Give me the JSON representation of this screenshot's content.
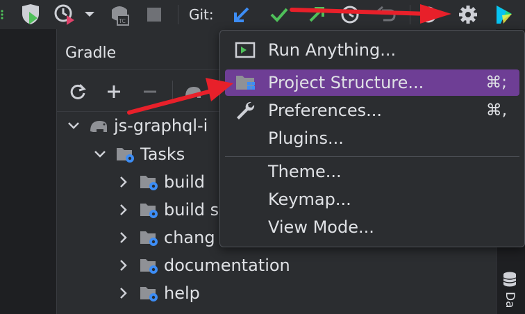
{
  "toolbar": {
    "git_label": "Git:",
    "icons": [
      "shield-run-icon",
      "profiler-icon",
      "dropdown-icon",
      "teamcity-icon",
      "stop-icon",
      "update-project-icon",
      "commit-icon",
      "push-icon",
      "history-icon",
      "rollback-icon",
      "search-everywhere-icon",
      "settings-icon",
      "toolbox-icon"
    ]
  },
  "gradle": {
    "title": "Gradle",
    "tools": [
      "refresh-icon",
      "add-icon",
      "remove-icon"
    ],
    "tree": [
      {
        "label": "js-graphql-i",
        "level": 0,
        "expanded": true
      },
      {
        "label": "Tasks",
        "level": 1,
        "expanded": true
      },
      {
        "label": "build",
        "level": 2,
        "expanded": false
      },
      {
        "label": "build s",
        "level": 2,
        "expanded": false
      },
      {
        "label": "chang",
        "level": 2,
        "expanded": false
      },
      {
        "label": "documentation",
        "level": 2,
        "expanded": false
      },
      {
        "label": "help",
        "level": 2,
        "expanded": false
      }
    ]
  },
  "menu": {
    "items": [
      {
        "label": "Run Anything...",
        "shortcut": "",
        "icon": "run-anything-icon"
      },
      {
        "label": "Project Structure...",
        "shortcut": "⌘;",
        "icon": "project-structure-icon",
        "selected": true
      },
      {
        "label": "Preferences...",
        "shortcut": "⌘,",
        "icon": "wrench-icon"
      },
      {
        "label": "Plugins...",
        "shortcut": "",
        "icon": ""
      },
      {
        "label": "Theme...",
        "shortcut": "",
        "icon": ""
      },
      {
        "label": "Keymap...",
        "shortcut": "",
        "icon": ""
      },
      {
        "label": "View Mode...",
        "shortcut": "",
        "icon": ""
      }
    ]
  },
  "right_strip": {
    "label": "Da"
  },
  "colors": {
    "selection": "#6e3e95",
    "arrow": "#e8202a",
    "git_blue": "#3d8df5",
    "git_green": "#4fc05a"
  }
}
